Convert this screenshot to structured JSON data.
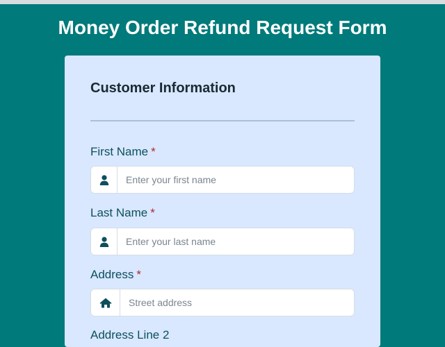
{
  "page": {
    "title": "Money Order Refund Request Form"
  },
  "section": {
    "title": "Customer Information"
  },
  "fields": {
    "first_name": {
      "label": "First Name",
      "required_mark": "*",
      "placeholder": "Enter your first name",
      "value": "",
      "icon": "user-icon"
    },
    "last_name": {
      "label": "Last Name",
      "required_mark": "*",
      "placeholder": "Enter your last name",
      "value": "",
      "icon": "user-icon"
    },
    "address": {
      "label": "Address",
      "required_mark": "*",
      "placeholder": "Street address",
      "value": "",
      "icon": "home-icon"
    },
    "address_line_2": {
      "label": "Address Line 2"
    }
  },
  "colors": {
    "background": "#007a7a",
    "card": "#d9e8ff",
    "label": "#0d4f5c",
    "required": "#b02a2a",
    "icon": "#0d4f5c"
  }
}
